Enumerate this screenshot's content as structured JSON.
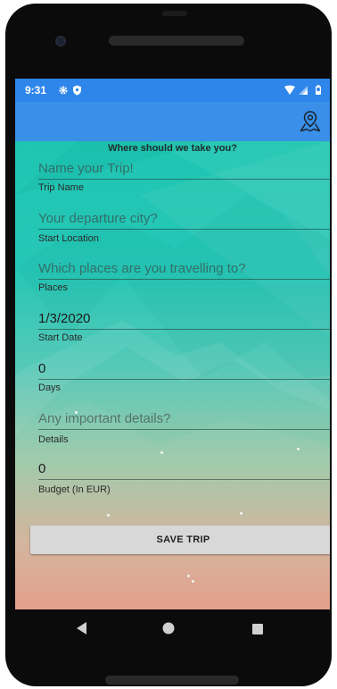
{
  "status_bar": {
    "time": "9:31",
    "icons": [
      "gear-icon",
      "shield-icon",
      "wifi-icon",
      "signal-icon",
      "battery-icon"
    ]
  },
  "app_bar": {
    "action_icon": "map-pin-icon"
  },
  "form": {
    "heading": "Where should we take you?",
    "fields": [
      {
        "placeholder": "Name your Trip!",
        "value": "",
        "label": "Trip Name"
      },
      {
        "placeholder": "Your departure city?",
        "value": "",
        "label": "Start Location"
      },
      {
        "placeholder": "Which places are you travelling to?",
        "value": "",
        "label": "Places"
      },
      {
        "placeholder": "",
        "value": "1/3/2020",
        "label": "Start Date"
      },
      {
        "placeholder": "",
        "value": "0",
        "label": "Days"
      },
      {
        "placeholder": "Any important details?",
        "value": "",
        "label": "Details"
      },
      {
        "placeholder": "",
        "value": "0",
        "label": "Budget (In EUR)"
      }
    ],
    "save_label": "SAVE TRIP"
  },
  "nav_bar": {
    "icons": [
      "back-icon",
      "home-icon",
      "recents-icon"
    ]
  },
  "colors": {
    "status_bar": "#2f86ea",
    "app_bar": "#3a8fe8",
    "gradient_top": "#1ec6b2",
    "gradient_bottom": "#e39c87",
    "button": "#d8d8d8"
  }
}
